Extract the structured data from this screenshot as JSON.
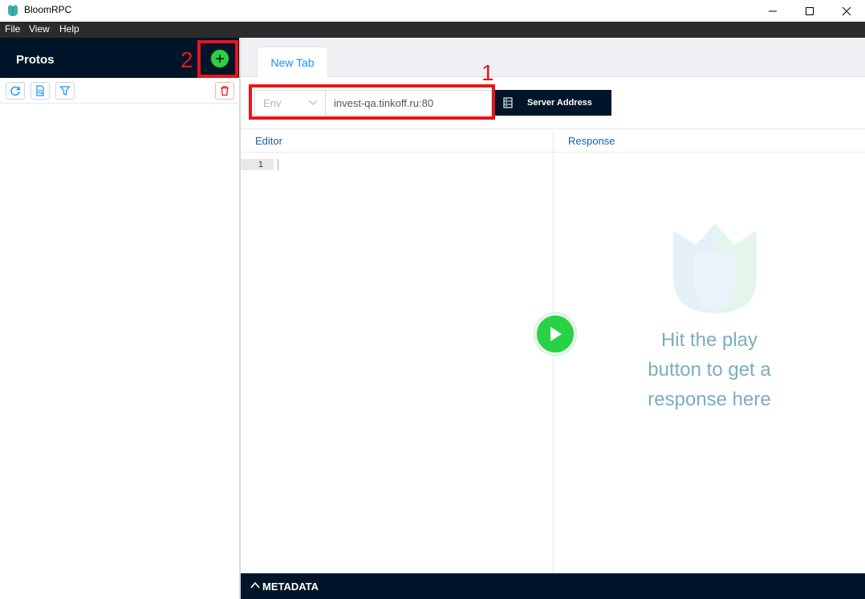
{
  "window": {
    "title": "BloomRPC"
  },
  "menu": [
    "File",
    "View",
    "Help"
  ],
  "sidebar": {
    "title": "Protos"
  },
  "annotations": {
    "one": "1",
    "two": "2"
  },
  "tabs": [
    {
      "label": "New Tab"
    }
  ],
  "address": {
    "env_placeholder": "Env",
    "server_url": "invest-qa.tinkoff.ru:80",
    "server_button_label": "Server Address"
  },
  "editor": {
    "label": "Editor",
    "line_number": "1"
  },
  "response": {
    "label": "Response",
    "hint_lines": [
      "Hit the play",
      "button to get a",
      "response here"
    ]
  },
  "metadata": {
    "label": "METADATA"
  },
  "colors": {
    "accent_green": "#28d245",
    "dark_navy": "#001529",
    "highlight_red": "#e8141c",
    "tab_blue": "#1890ff"
  },
  "icons": {
    "add": "plus-circle-icon",
    "reload": "reload-icon",
    "import": "file-search-icon",
    "filter": "filter-icon",
    "delete": "trash-icon",
    "server": "database-icon",
    "play": "play-icon"
  }
}
